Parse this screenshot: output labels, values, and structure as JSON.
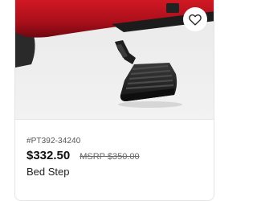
{
  "product": {
    "part_number": "#PT392-34240",
    "price": "$332.50",
    "msrp": "MSRP $350.00",
    "title": "Bed Step",
    "image": "truck-bumper-bed-step-photo",
    "favorite_icon": "heart-outline-icon"
  },
  "colors": {
    "truck_red": "#b3101c",
    "step_black": "#1b1b1b",
    "image_bg": "#ececec"
  }
}
